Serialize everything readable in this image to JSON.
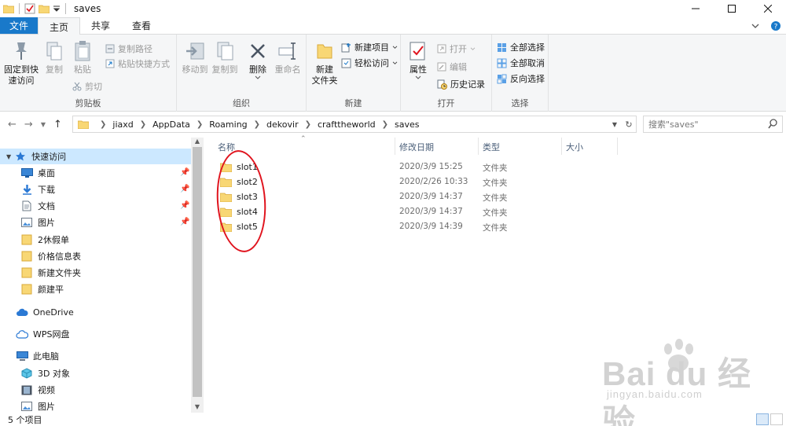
{
  "window": {
    "title": "saves"
  },
  "tabs": [
    {
      "label": "文件"
    },
    {
      "label": "主页"
    },
    {
      "label": "共享"
    },
    {
      "label": "查看"
    }
  ],
  "ribbon": {
    "clipboard": {
      "label": "剪贴板",
      "pin": "固定到快\n速访问",
      "copy": "复制",
      "paste": "粘贴",
      "copy_path": "复制路径",
      "paste_shortcut": "粘贴快捷方式",
      "cut": "剪切"
    },
    "organize": {
      "label": "组织",
      "move_to": "移动到",
      "copy_to": "复制到",
      "delete": "删除",
      "rename": "重命名"
    },
    "new": {
      "label": "新建",
      "new_folder": "新建\n文件夹",
      "new_item": "新建项目",
      "easy_access": "轻松访问"
    },
    "open": {
      "label": "打开",
      "properties": "属性",
      "open": "打开",
      "edit": "编辑",
      "history": "历史记录"
    },
    "select": {
      "label": "选择",
      "select_all": "全部选择",
      "select_none": "全部取消",
      "invert": "反向选择"
    }
  },
  "address": {
    "crumbs": [
      "jiaxd",
      "AppData",
      "Roaming",
      "dekovir",
      "crafttheworld",
      "saves"
    ],
    "search_placeholder": "搜索\"saves\""
  },
  "nav": {
    "quick_access": "快速访问",
    "items": [
      {
        "label": "桌面",
        "pinned": true
      },
      {
        "label": "下载",
        "pinned": true
      },
      {
        "label": "文档",
        "pinned": true
      },
      {
        "label": "图片",
        "pinned": true
      },
      {
        "label": "2休假单"
      },
      {
        "label": "价格信息表"
      },
      {
        "label": "新建文件夹"
      },
      {
        "label": "颜建平"
      }
    ],
    "onedrive": "OneDrive",
    "wps": "WPS网盘",
    "this_pc": "此电脑",
    "pc_items": [
      {
        "label": "3D 对象"
      },
      {
        "label": "视频"
      },
      {
        "label": "图片"
      }
    ]
  },
  "list": {
    "columns": {
      "name": "名称",
      "date": "修改日期",
      "type": "类型",
      "size": "大小"
    },
    "rows": [
      {
        "name": "slot1",
        "date": "2020/3/9 15:25",
        "type": "文件夹"
      },
      {
        "name": "slot2",
        "date": "2020/2/26 10:33",
        "type": "文件夹"
      },
      {
        "name": "slot3",
        "date": "2020/3/9 14:37",
        "type": "文件夹"
      },
      {
        "name": "slot4",
        "date": "2020/3/9 14:37",
        "type": "文件夹"
      },
      {
        "name": "slot5",
        "date": "2020/3/9 14:39",
        "type": "文件夹"
      }
    ]
  },
  "status": {
    "count": "5 个项目"
  },
  "watermark": {
    "brand": "Bai du 经验",
    "url": "jingyan.baidu.com"
  },
  "colors": {
    "file_tab": "#1979ca",
    "selection": "#cce8ff",
    "annotation": "#e0141e",
    "folder": "#f8d775"
  }
}
